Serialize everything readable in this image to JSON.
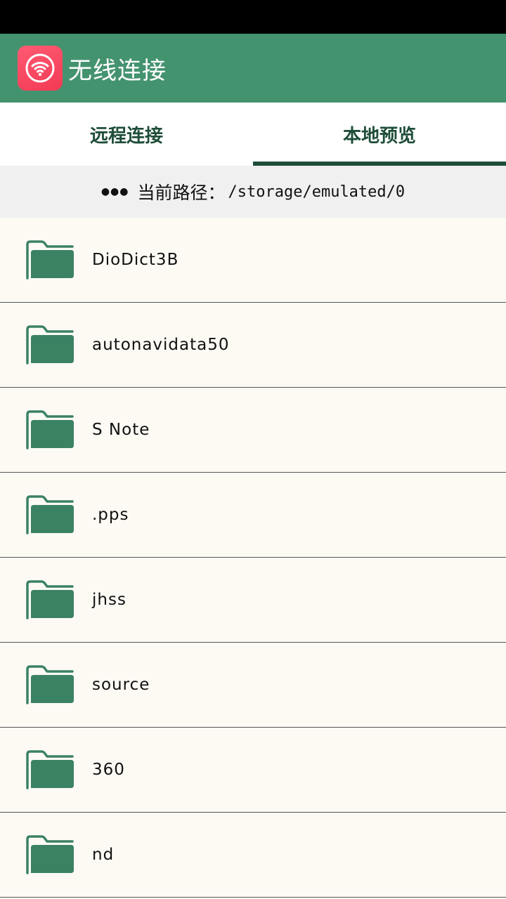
{
  "app": {
    "title": "无线连接",
    "icon": "wifi-icon",
    "accent_color": "#44936f",
    "icon_color": "#f33a55"
  },
  "tabs": [
    {
      "label": "远程连接",
      "active": false
    },
    {
      "label": "本地预览",
      "active": true
    }
  ],
  "path_bar": {
    "dots": "●●●",
    "label": "当前路径：",
    "value": "/storage/emulated/0"
  },
  "files": [
    {
      "name": "DioDict3B",
      "icon": "folder-icon"
    },
    {
      "name": "autonavidata50",
      "icon": "folder-icon"
    },
    {
      "name": "S Note",
      "icon": "folder-icon"
    },
    {
      "name": ".pps",
      "icon": "folder-icon"
    },
    {
      "name": "jhss",
      "icon": "folder-icon"
    },
    {
      "name": "source",
      "icon": "folder-icon"
    },
    {
      "name": "360",
      "icon": "folder-icon"
    },
    {
      "name": "nd",
      "icon": "folder-icon"
    }
  ]
}
